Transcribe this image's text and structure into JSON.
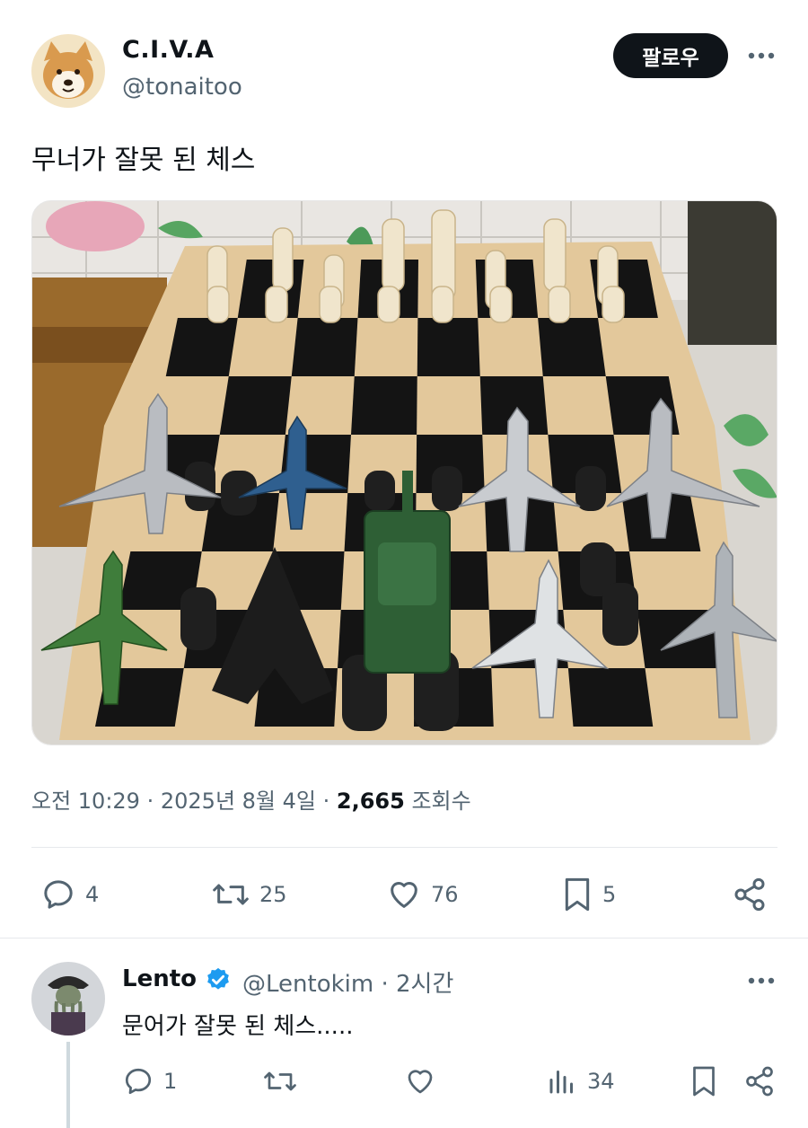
{
  "post": {
    "author": {
      "name": "C.I.V.A",
      "handle": "@tonaitoo",
      "avatar": "shiba-dog-avatar"
    },
    "follow_label": "팔로우",
    "text": "무너가 잘못 된 체스",
    "media": {
      "description_icon": "chessboard-with-toy-jets-and-tank-photo"
    },
    "meta": {
      "time": "오전 10:29",
      "date": "2025년 8월 4일",
      "views": "2,665",
      "views_label": "조회수"
    },
    "stats": {
      "replies": "4",
      "reposts": "25",
      "likes": "76",
      "bookmarks": "5"
    }
  },
  "reply": {
    "author": {
      "name": "Lento",
      "handle": "@Lentokim",
      "time": "2시간",
      "avatar": "octopus-captain-avatar",
      "verified": true
    },
    "text": "문어가 잘못 된 체스.....",
    "stats": {
      "replies": "1",
      "views": "34"
    }
  },
  "colors": {
    "accent": "#1d9bf0",
    "muted": "#536471",
    "text": "#0f1419"
  }
}
